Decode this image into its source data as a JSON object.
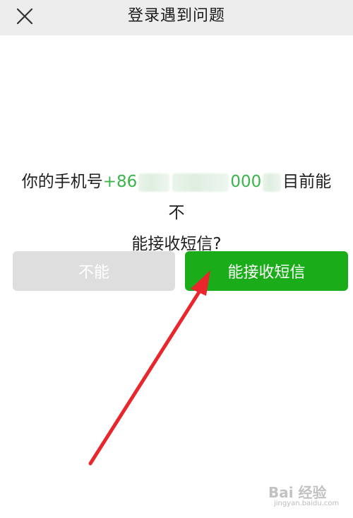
{
  "header": {
    "title": "登录遇到问题",
    "close_icon": "close-icon"
  },
  "prompt": {
    "prefix": "你的手机号",
    "phone_code": "+86",
    "phone_visible_part": "000",
    "suffix_line1": "目前能不",
    "line2": "能接收短信?"
  },
  "buttons": {
    "cannot_label": "不能",
    "can_label": "能接收短信"
  },
  "colors": {
    "accent_green": "#1aad19",
    "phone_green": "#3bb54a",
    "disabled_gray": "#dedede",
    "arrow_red": "#e8262b"
  },
  "watermark": {
    "brand": "Bai 经验",
    "url": "jingyan.baidu.com"
  }
}
